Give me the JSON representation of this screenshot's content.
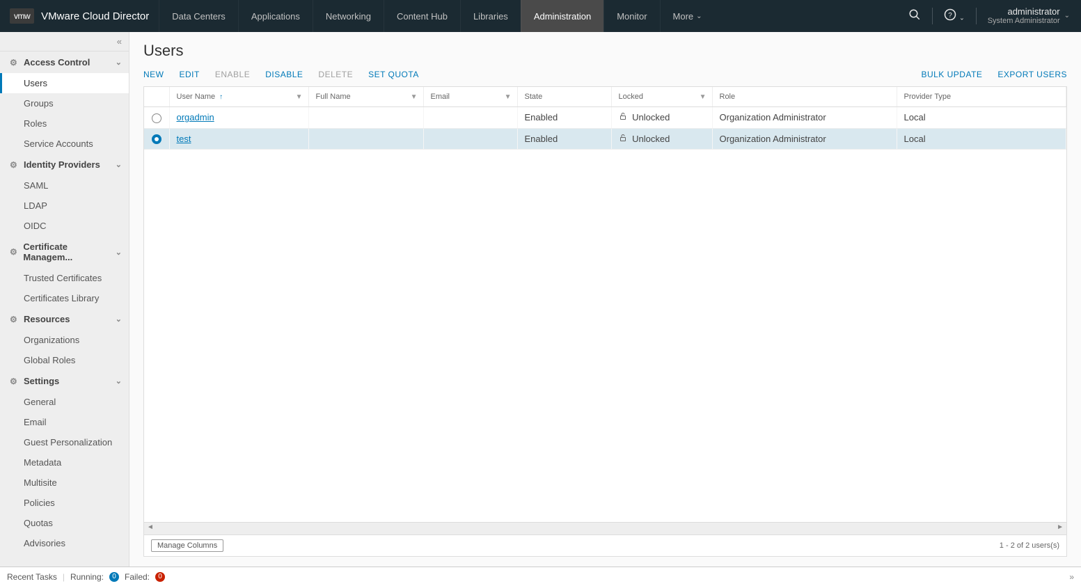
{
  "header": {
    "logo_text": "vmw",
    "product_name": "VMware Cloud Director",
    "nav": [
      {
        "label": "Data Centers",
        "active": false
      },
      {
        "label": "Applications",
        "active": false
      },
      {
        "label": "Networking",
        "active": false
      },
      {
        "label": "Content Hub",
        "active": false
      },
      {
        "label": "Libraries",
        "active": false
      },
      {
        "label": "Administration",
        "active": true
      },
      {
        "label": "Monitor",
        "active": false
      },
      {
        "label": "More",
        "active": false,
        "dropdown": true
      }
    ],
    "user": {
      "name": "administrator",
      "role": "System Administrator"
    }
  },
  "sidebar": {
    "sections": [
      {
        "label": "Access Control",
        "items": [
          "Users",
          "Groups",
          "Roles",
          "Service Accounts"
        ],
        "active_item": "Users"
      },
      {
        "label": "Identity Providers",
        "items": [
          "SAML",
          "LDAP",
          "OIDC"
        ]
      },
      {
        "label": "Certificate Managem...",
        "items": [
          "Trusted Certificates",
          "Certificates Library"
        ]
      },
      {
        "label": "Resources",
        "items": [
          "Organizations",
          "Global Roles"
        ]
      },
      {
        "label": "Settings",
        "items": [
          "General",
          "Email",
          "Guest Personalization",
          "Metadata",
          "Multisite",
          "Policies",
          "Quotas",
          "Advisories"
        ]
      }
    ]
  },
  "page": {
    "title": "Users",
    "actions": [
      {
        "label": "NEW",
        "enabled": true
      },
      {
        "label": "EDIT",
        "enabled": true
      },
      {
        "label": "ENABLE",
        "enabled": false
      },
      {
        "label": "DISABLE",
        "enabled": true
      },
      {
        "label": "DELETE",
        "enabled": false
      },
      {
        "label": "SET QUOTA",
        "enabled": true
      }
    ],
    "actions_right": [
      {
        "label": "BULK UPDATE"
      },
      {
        "label": "EXPORT USERS"
      }
    ],
    "columns": [
      "User Name",
      "Full Name",
      "Email",
      "State",
      "Locked",
      "Role",
      "Provider Type"
    ],
    "rows": [
      {
        "selected": false,
        "username": "orgadmin",
        "fullname": "",
        "email": "",
        "state": "Enabled",
        "locked": "Unlocked",
        "role": "Organization Administrator",
        "provider": "Local"
      },
      {
        "selected": true,
        "username": "test",
        "fullname": "",
        "email": "",
        "state": "Enabled",
        "locked": "Unlocked",
        "role": "Organization Administrator",
        "provider": "Local"
      }
    ],
    "manage_columns": "Manage Columns",
    "count_text": "1 - 2 of 2 users(s)"
  },
  "statusbar": {
    "recent_tasks": "Recent Tasks",
    "running_label": "Running:",
    "running_count": "0",
    "failed_label": "Failed:",
    "failed_count": "0"
  }
}
